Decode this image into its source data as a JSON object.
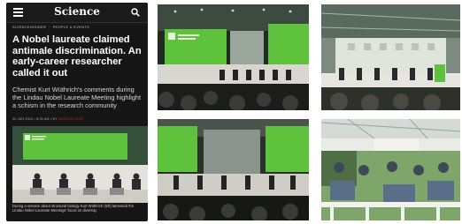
{
  "phone": {
    "brand": "Science",
    "breadcrumb": {
      "section": "SCIENCEINSIDER",
      "subsection": "PEOPLE & EVENTS"
    },
    "headline": "A Nobel laureate claimed antimale discrimination. An early-career researcher called it out",
    "dek": "Chemist Kurt Wüthrich's comments during the Lindau Nobel Laureate Meeting highlight a schism in the research community",
    "date": "30 JUN 2023",
    "time": "8:25 AM",
    "author": "AMANDA HEIDT",
    "caption": "During a session about structural biology Kurt Wüthrich (left) lamented the Lindau Nobel Laureate Meetings' focus on diversity."
  },
  "colors": {
    "stage_green": "#5fc23d",
    "phone_bg": "#161616",
    "accent_red": "#c62828"
  },
  "icons": [
    "menu-icon",
    "search-icon"
  ]
}
